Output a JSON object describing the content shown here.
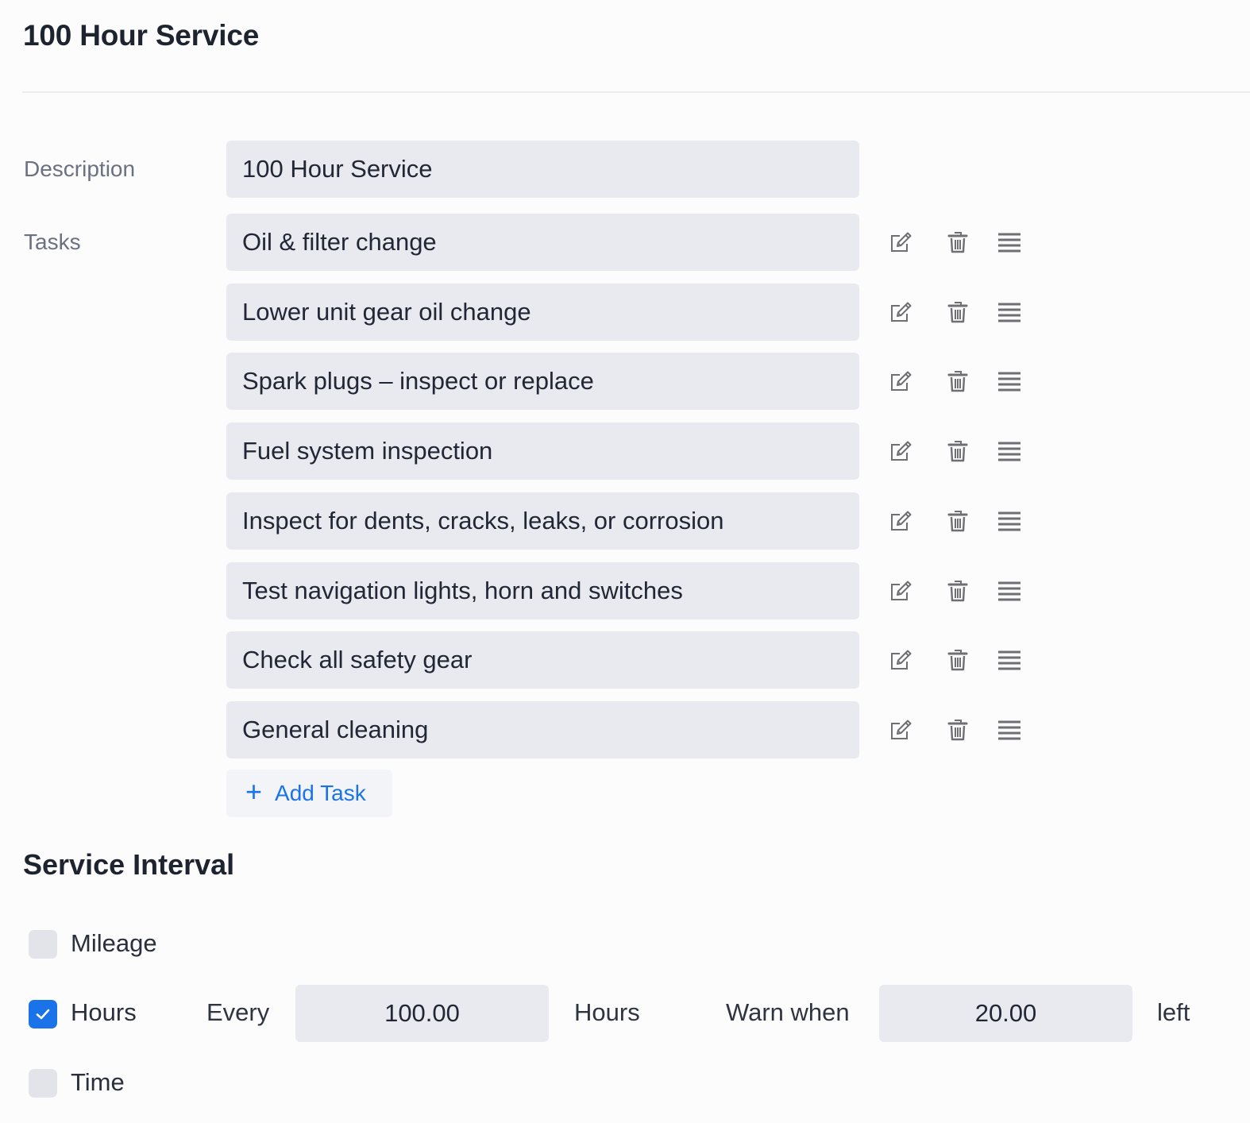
{
  "page": {
    "title": "100 Hour Service"
  },
  "form": {
    "description_label": "Description",
    "description_value": "100 Hour Service",
    "tasks_label": "Tasks",
    "tasks": [
      {
        "label": "Oil & filter change"
      },
      {
        "label": "Lower unit gear oil change"
      },
      {
        "label": "Spark plugs – inspect or replace"
      },
      {
        "label": "Fuel system inspection"
      },
      {
        "label": "Inspect for dents, cracks, leaks, or corrosion"
      },
      {
        "label": "Test navigation lights, horn and switches"
      },
      {
        "label": "Check all safety gear"
      },
      {
        "label": "General cleaning"
      }
    ],
    "task_actions": [
      "edit-icon",
      "trash-icon",
      "drag-handle-icon"
    ],
    "add_task_label": "Add Task"
  },
  "service_interval": {
    "title": "Service Interval",
    "mileage": {
      "label": "Mileage",
      "checked": false
    },
    "hours": {
      "label": "Hours",
      "checked": true,
      "every_label": "Every",
      "every_value": "100.00",
      "unit_label": "Hours",
      "warn_label": "Warn when",
      "warn_value": "20.00",
      "left_label": "left"
    },
    "time": {
      "label": "Time",
      "checked": false
    }
  },
  "colors": {
    "accent": "#1a73e8",
    "input_bg": "#e9eaf0",
    "label": "#6b7180",
    "icon": "#6e6e73"
  }
}
